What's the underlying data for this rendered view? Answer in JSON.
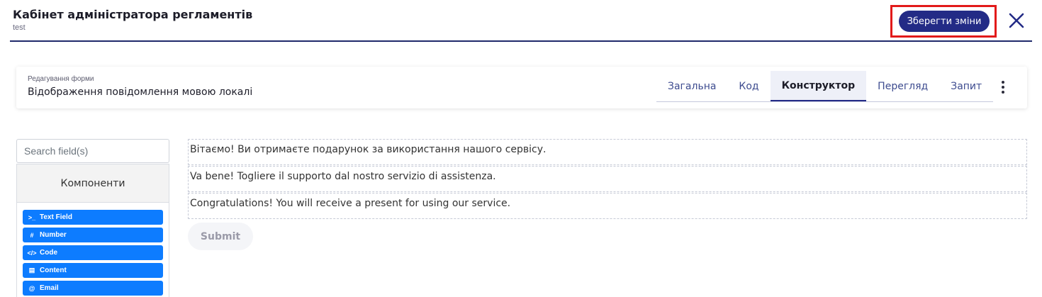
{
  "header": {
    "title": "Кабінет адміністратора регламентів",
    "subtitle": "test",
    "save_label": "Зберегти зміни",
    "close_icon": "close-icon"
  },
  "form_card": {
    "caption": "Редагування форми",
    "name": "Відображення повідомлення мовою локалі",
    "tabs": [
      {
        "label": "Загальна",
        "active": false
      },
      {
        "label": "Код",
        "active": false
      },
      {
        "label": "Конструктор",
        "active": true
      },
      {
        "label": "Перегляд",
        "active": false
      },
      {
        "label": "Запит",
        "active": false
      }
    ],
    "more_icon": "more-vertical-icon"
  },
  "builder": {
    "search_placeholder": "Search field(s)",
    "components_title": "Компоненти",
    "components": [
      {
        "icon": ">_",
        "label": "Text Field"
      },
      {
        "icon": "#",
        "label": "Number"
      },
      {
        "icon": "</>",
        "label": "Code"
      },
      {
        "icon": "▤",
        "label": "Content"
      },
      {
        "icon": "@",
        "label": "Email"
      }
    ]
  },
  "canvas": {
    "fields": [
      "Вітаємо! Ви отримаєте подарунок за використання нашого сервісу.",
      "Va bene! Togliere il supporto dal nostro servizio di assistenza.",
      "Congratulations! You will receive a present for using our service."
    ],
    "submit_label": "Submit"
  },
  "colors": {
    "accent": "#232b86",
    "highlight": "#e21a1a",
    "component": "#0d7cff"
  }
}
